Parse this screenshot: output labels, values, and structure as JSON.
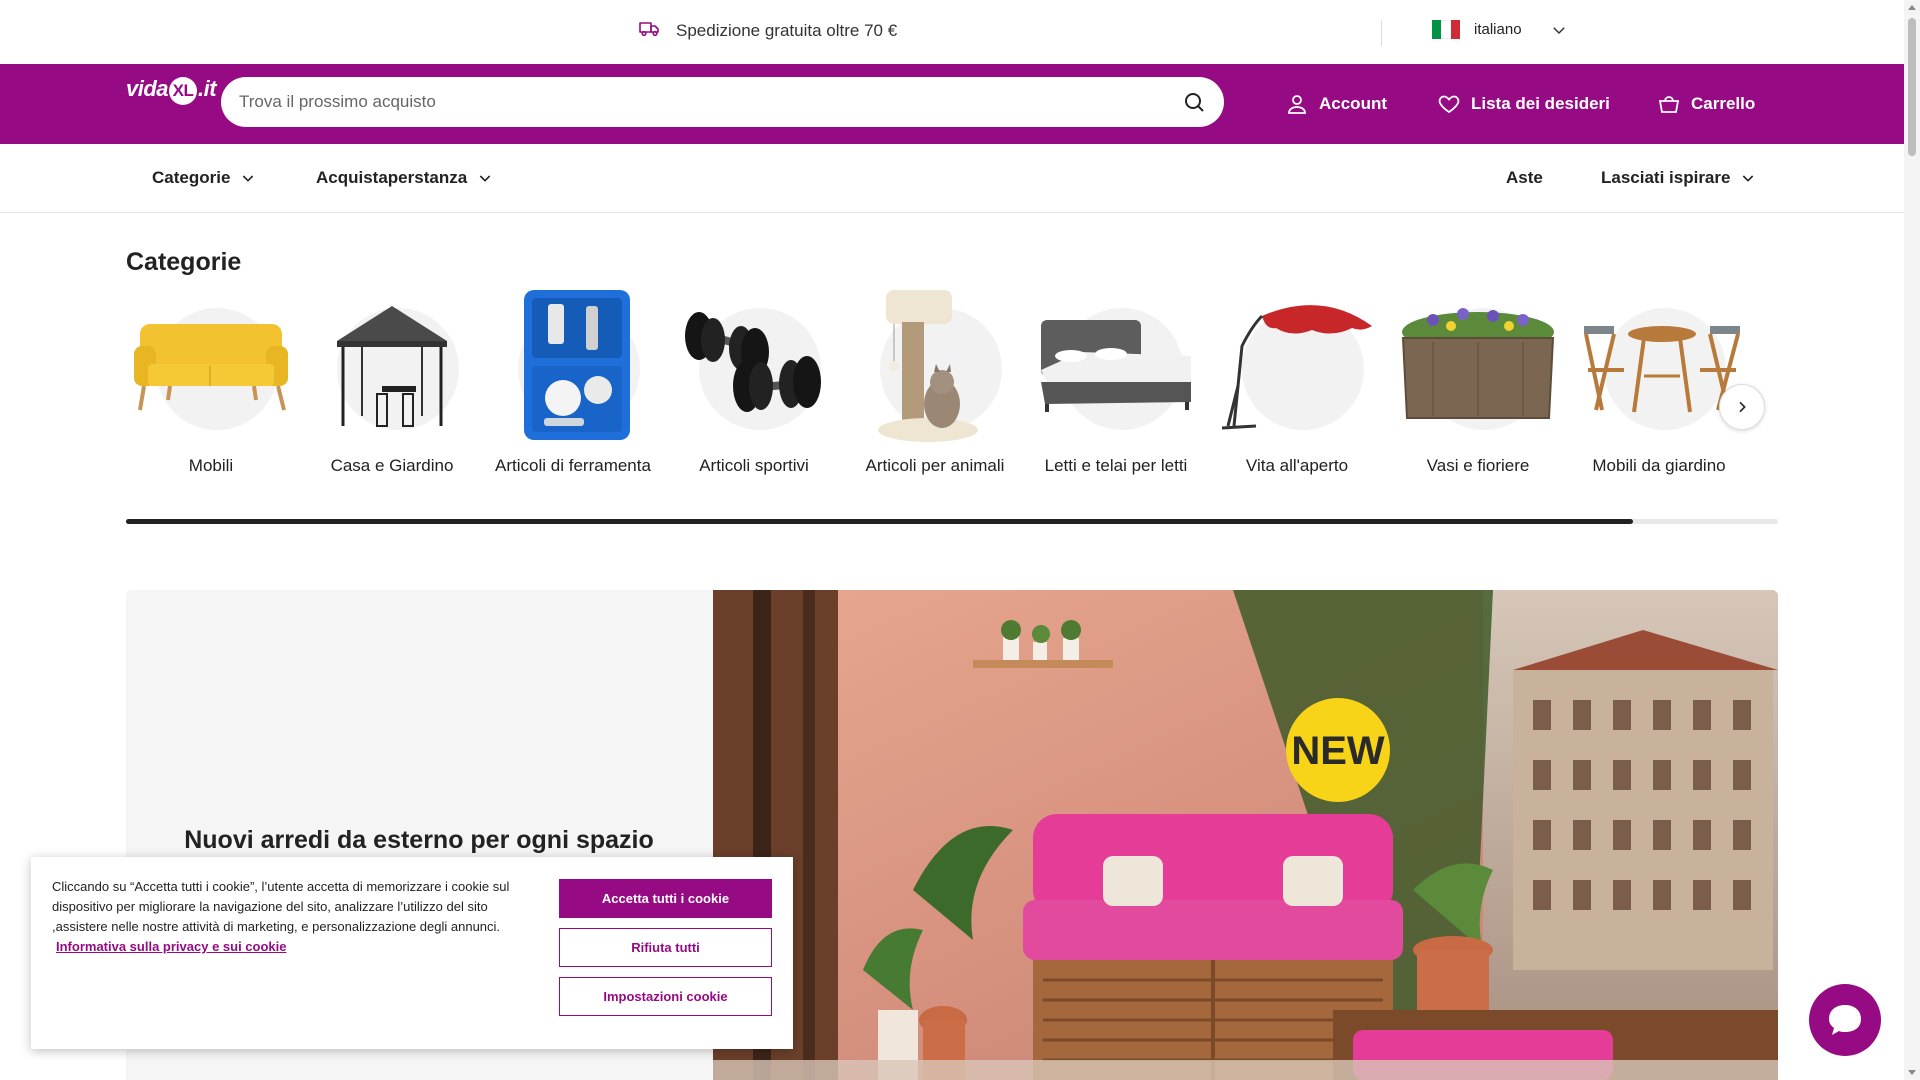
{
  "topbar": {
    "shipping_text": "Spedizione gratuita oltre 70 €",
    "language": "italiano"
  },
  "header": {
    "logo_text": "vidaXL.it",
    "search_placeholder": "Trova il prossimo acquisto",
    "account_label": "Account",
    "wishlist_label": "Lista dei desideri",
    "cart_label": "Carrello"
  },
  "subnav": {
    "categories": "Categorie",
    "shop_by_room": "Acquistaperstanza",
    "auctions": "Aste",
    "inspire": "Lasciati ispirare"
  },
  "categories": {
    "title": "Categorie",
    "items": [
      {
        "label": "Mobili",
        "icon": "sofa-icon"
      },
      {
        "label": "Casa e Giardino",
        "icon": "gazebo-icon"
      },
      {
        "label": "Articoli di ferramenta",
        "icon": "toolcase-icon"
      },
      {
        "label": "Articoli sportivi",
        "icon": "dumbbell-icon"
      },
      {
        "label": "Articoli per animali",
        "icon": "cat-tree-icon"
      },
      {
        "label": "Letti e telai per letti",
        "icon": "bed-icon"
      },
      {
        "label": "Vita all'aperto",
        "icon": "parasol-icon"
      },
      {
        "label": "Vasi e fioriere",
        "icon": "planter-icon"
      },
      {
        "label": "Mobili da giardino",
        "icon": "bistro-set-icon"
      }
    ],
    "scroll_progress": 0.912
  },
  "banner": {
    "headline": "Nuovi arredi da esterno per ogni spazio",
    "badge": "NEW"
  },
  "cookie": {
    "text": "Cliccando su “Accetta tutti i cookie”, l’utente accetta di memorizzare i cookie sul dispositivo per migliorare la navigazione del sito, analizzare l’utilizzo del sito ,assistere nelle nostre attività di marketing, e personalizzazione degli annunci.",
    "link": "Informativa sulla privacy e sui cookie",
    "accept": "Accetta tutti i cookie",
    "reject": "Rifiuta tutti",
    "settings": "Impostazioni cookie"
  },
  "colors": {
    "brand": "#960b83",
    "flag_green": "#009246",
    "flag_white": "#ffffff",
    "flag_red": "#ce2b37"
  }
}
